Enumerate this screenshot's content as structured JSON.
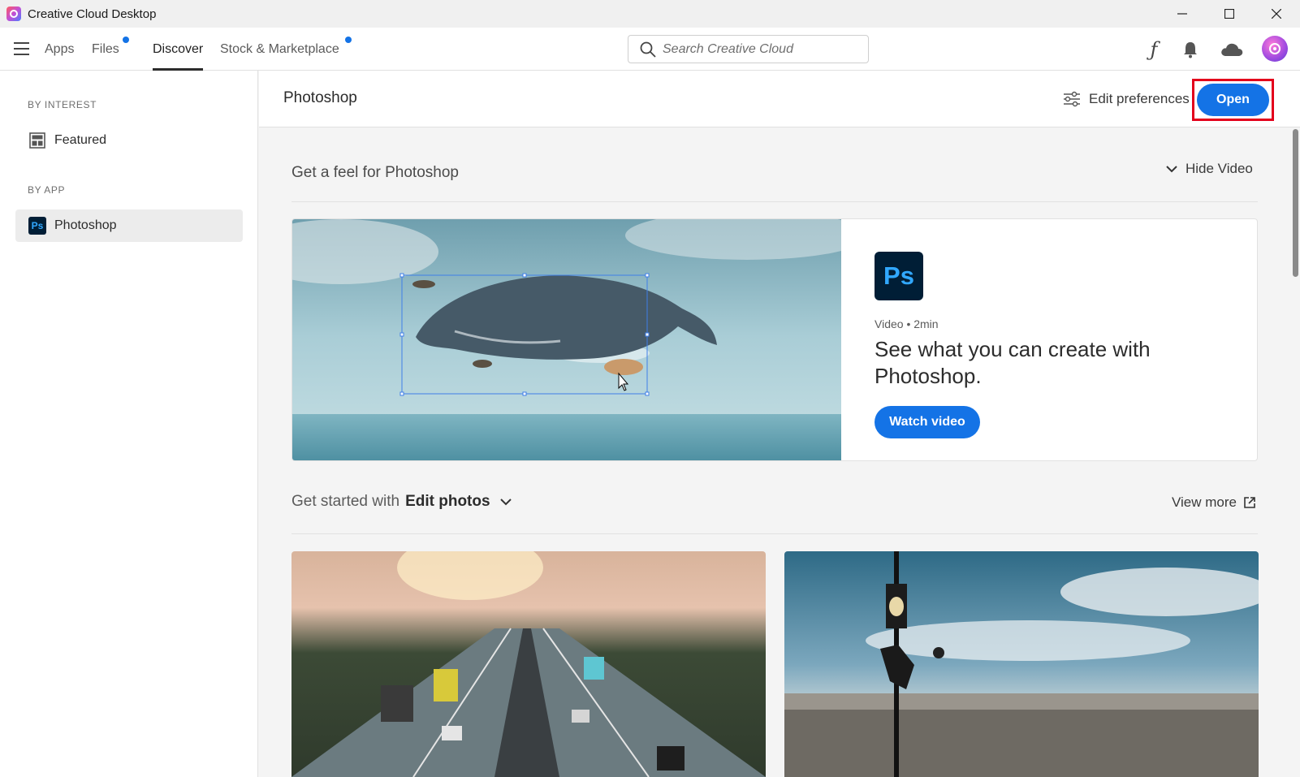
{
  "window": {
    "title": "Creative Cloud Desktop",
    "controls": [
      "minimize-icon",
      "maximize-icon",
      "close-icon"
    ]
  },
  "nav": {
    "tabs": [
      {
        "label": "Apps",
        "active": false,
        "notification": false
      },
      {
        "label": "Files",
        "active": false,
        "notification": true
      },
      {
        "label": "Discover",
        "active": true,
        "notification": false
      },
      {
        "label": "Stock & Marketplace",
        "active": false,
        "notification": true
      }
    ],
    "search": {
      "placeholder": "Search Creative Cloud",
      "value": ""
    },
    "icons": [
      "fonts-icon",
      "bell-icon",
      "cloud-icon",
      "avatar"
    ]
  },
  "sidebar": {
    "by_interest_heading": "BY INTEREST",
    "featured_label": "Featured",
    "by_app_heading": "BY APP",
    "photoshop_label": "Photoshop",
    "ps_badge": "Ps"
  },
  "header": {
    "title": "Photoshop",
    "edit_prefs_label": "Edit preferences",
    "open_label": "Open"
  },
  "feel": {
    "title": "Get a feel for Photoshop",
    "hide_video_label": "Hide Video",
    "ps_logo_text": "Ps",
    "meta": "Video • 2min",
    "headline": "See what you can create with Photoshop.",
    "watch_label": "Watch video"
  },
  "get_started": {
    "prefix": "Get started with",
    "topic": "Edit photos",
    "view_more_label": "View more"
  },
  "colors": {
    "accent": "#1473e6",
    "highlight_border": "#e3001b",
    "ps_dark": "#001e36",
    "ps_blue": "#31a8ff"
  }
}
